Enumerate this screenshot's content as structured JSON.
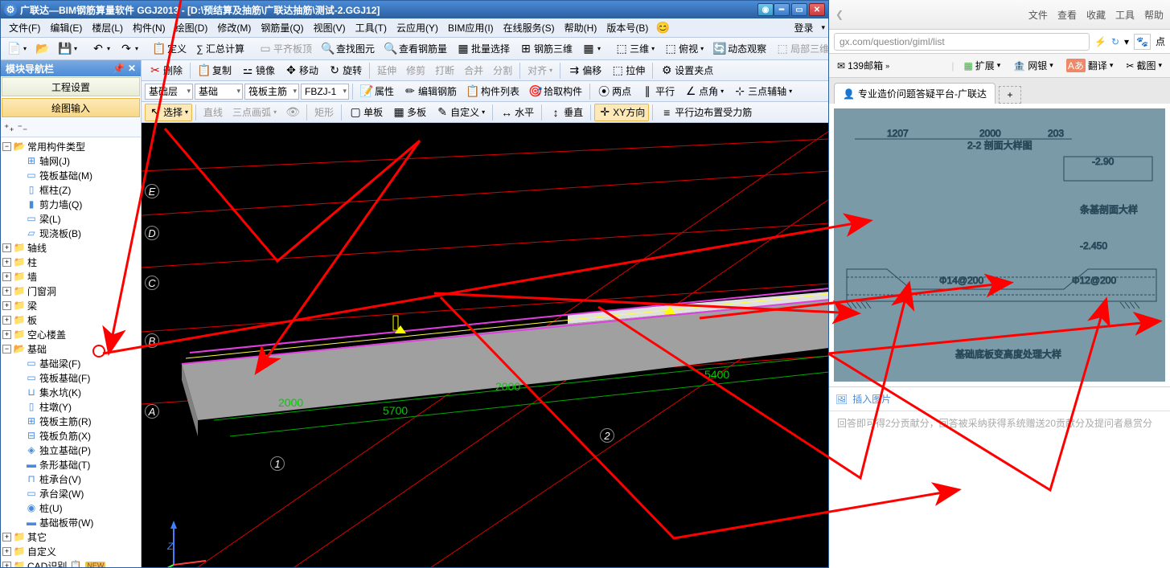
{
  "titlebar": {
    "text": "广联达—BIM钢筋算量软件 GGJ2013 - [D:\\预结算及抽筋\\广联达抽筋\\测试-2.GGJ12]"
  },
  "menus": {
    "file": "文件(F)",
    "edit": "编辑(E)",
    "floor": "楼层(L)",
    "component": "构件(N)",
    "draw": "绘图(D)",
    "modify": "修改(M)",
    "rebar": "钢筋量(Q)",
    "view": "视图(V)",
    "tool": "工具(T)",
    "cloud": "云应用(Y)",
    "bim": "BIM应用(I)",
    "online": "在线服务(S)",
    "help": "帮助(H)",
    "version": "版本号(B)",
    "login": "登录"
  },
  "toolbar1": {
    "define": "定义",
    "sum": "∑ 汇总计算",
    "flatTop": "平齐板顶",
    "findGrid": "查找图元",
    "viewRebar": "查看钢筋量",
    "batchSel": "批量选择",
    "rebar3d": "钢筋三维",
    "threeD": "三维",
    "overlook": "俯视",
    "dynObs": "动态观察",
    "local3d": "局部三维"
  },
  "toolbar2": {
    "delete": "删除",
    "copy": "复制",
    "mirror": "镜像",
    "move": "移动",
    "rotate": "旋转",
    "extend": "延伸",
    "trim": "修剪",
    "break": "打断",
    "merge": "合并",
    "split": "分割",
    "align": "对齐",
    "offset": "偏移",
    "stretch": "拉伸",
    "setClamp": "设置夹点"
  },
  "toolbar3": {
    "floorCombo": "基础层",
    "catCombo": "基础",
    "subCombo": "筏板主筋",
    "nameCombo": "FBZJ-1",
    "attr": "属性",
    "editRebar": "编辑钢筋",
    "compList": "构件列表",
    "pick": "拾取构件",
    "twoPoint": "两点",
    "parallel": "平行",
    "corner": "点角",
    "threeAux": "三点辅轴"
  },
  "toolbar4": {
    "select": "选择",
    "line": "直线",
    "arc3": "三点画弧",
    "rect": "矩形",
    "single": "单板",
    "multi": "多板",
    "custom": "自定义",
    "horiz": "水平",
    "vert": "垂直",
    "xyDir": "XY方向",
    "edgeForce": "平行边布置受力筋"
  },
  "leftPanel": {
    "header": "模块导航栏",
    "section1": "工程设置",
    "section2": "绘图输入",
    "rootNode": "常用构件类型",
    "axisGrid": "轴网(J)",
    "raftBase": "筏板基础(M)",
    "frameCol": "框柱(Z)",
    "shearWall": "剪力墙(Q)",
    "beam": "梁(L)",
    "slab": "现浇板(B)",
    "axis": "轴线",
    "column": "柱",
    "wall": "墙",
    "doorWindow": "门窗洞",
    "beamCat": "梁",
    "slabCat": "板",
    "hollow": "空心楼盖",
    "foundation": "基础",
    "baseBeam": "基础梁(F)",
    "raftBaseItem": "筏板基础(F)",
    "sump": "集水坑(K)",
    "pier": "柱墩(Y)",
    "raftMain": "筏板主筋(R)",
    "raftNeg": "筏板负筋(X)",
    "indep": "独立基础(P)",
    "strip": "条形基础(T)",
    "pileCap": "桩承台(V)",
    "capBeam": "承台梁(W)",
    "pile": "桩(U)",
    "baseStrip": "基础板带(W)",
    "other": "其它",
    "custom": "自定义",
    "cad": "CAD识别"
  },
  "viewport": {
    "axisA": "A",
    "axisB": "B",
    "axisC": "C",
    "axisD": "D",
    "axisE": "E",
    "axis1": "1",
    "axis2": "2",
    "dim1": "2000",
    "dim2": "5700",
    "dim3": "2000",
    "dim4": "5400",
    "zAxis": "Z"
  },
  "browser": {
    "topMenu": {
      "file": "文件",
      "view": "查看",
      "fav": "收藏",
      "tool": "工具",
      "help": "帮助"
    },
    "url": "gx.com/question/giml/list",
    "bookmark139": "139邮箱",
    "ext": "扩展",
    "bank": "网银",
    "translate": "翻译",
    "screenshot": "截图",
    "dot": "点",
    "tabTitle": "专业造价问题答疑平台-广联达",
    "insertImg": "插入图片",
    "replyHint": "回答即可得2分贡献分，回答被采纳获得系统赠送20贡献分及提问者悬赏分",
    "blueprint": {
      "title1": "2-2 剖面大样图",
      "title2": "条基剖面大样",
      "title3": "基础底板变高度处理大样",
      "dim1": "1207",
      "dim2": "2000",
      "dim3": "203",
      "elev": "-2.90",
      "rebar1": "Φ14@200",
      "rebar2": "Φ12@200",
      "elev2": "-2.450"
    }
  }
}
